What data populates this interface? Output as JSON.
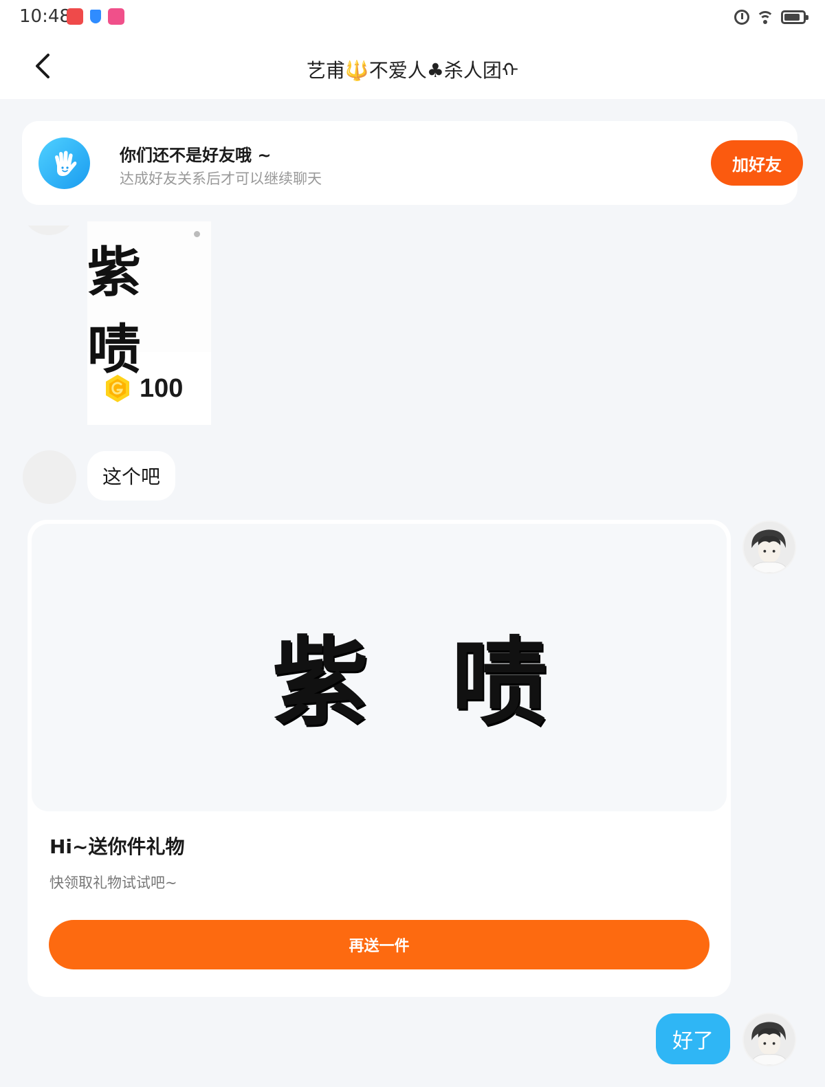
{
  "status_bar": {
    "time": "10:48"
  },
  "header": {
    "title": "艺甫🔱不爱人♣杀人团ᡣ"
  },
  "friend_banner": {
    "title": "你们还不是好友哦 ~",
    "subtitle": "达成好友关系后才可以继续聊天",
    "add_button": "加好友"
  },
  "messages": {
    "incoming_gift": {
      "sticker_text": "紫 啧",
      "price": "100",
      "currency_icon": "gold-coin-icon"
    },
    "incoming_text": "这个吧",
    "outgoing_gift": {
      "sticker_text": "紫 啧",
      "title": "Hi~送你件礼物",
      "subtitle": "快领取礼物试试吧~",
      "resend_button": "再送一件"
    },
    "outgoing_text": "好了"
  },
  "colors": {
    "accent_orange": "#fd6a10",
    "bubble_blue": "#2fb6f5",
    "page_background": "#f4f6f9"
  }
}
